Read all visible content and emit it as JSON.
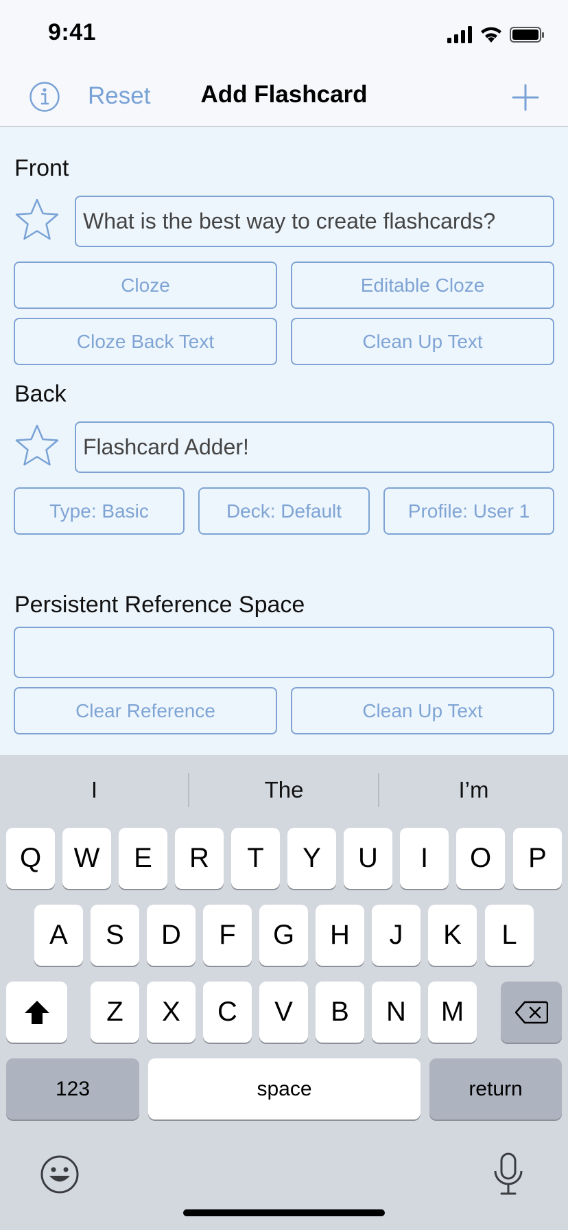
{
  "status_bar": {
    "time": "9:41"
  },
  "nav": {
    "reset_label": "Reset",
    "title": "Add Flashcard"
  },
  "front": {
    "label": "Front",
    "value": "What is the best way to create flashcards?",
    "buttons": [
      "Cloze",
      "Editable Cloze",
      "Cloze Back Text",
      "Clean Up Text"
    ]
  },
  "back": {
    "label": "Back",
    "value": "Flashcard Adder!",
    "buttons": [
      "Type: Basic",
      "Deck: Default",
      "Profile: User 1"
    ]
  },
  "reference": {
    "label": "Persistent Reference Space",
    "value": "",
    "buttons": [
      "Clear Reference",
      "Clean Up Text"
    ]
  },
  "keyboard": {
    "suggestions": [
      "I",
      "The",
      "I’m"
    ],
    "row1": [
      "Q",
      "W",
      "E",
      "R",
      "T",
      "Y",
      "U",
      "I",
      "O",
      "P"
    ],
    "row2": [
      "A",
      "S",
      "D",
      "F",
      "G",
      "H",
      "J",
      "K",
      "L"
    ],
    "row3": [
      "Z",
      "X",
      "C",
      "V",
      "B",
      "N",
      "M"
    ],
    "numbers_label": "123",
    "space_label": "space",
    "return_label": "return"
  },
  "colors": {
    "accent": "#78a2d6",
    "background": "#edf5fc",
    "keyboard": "#d3d7de"
  }
}
